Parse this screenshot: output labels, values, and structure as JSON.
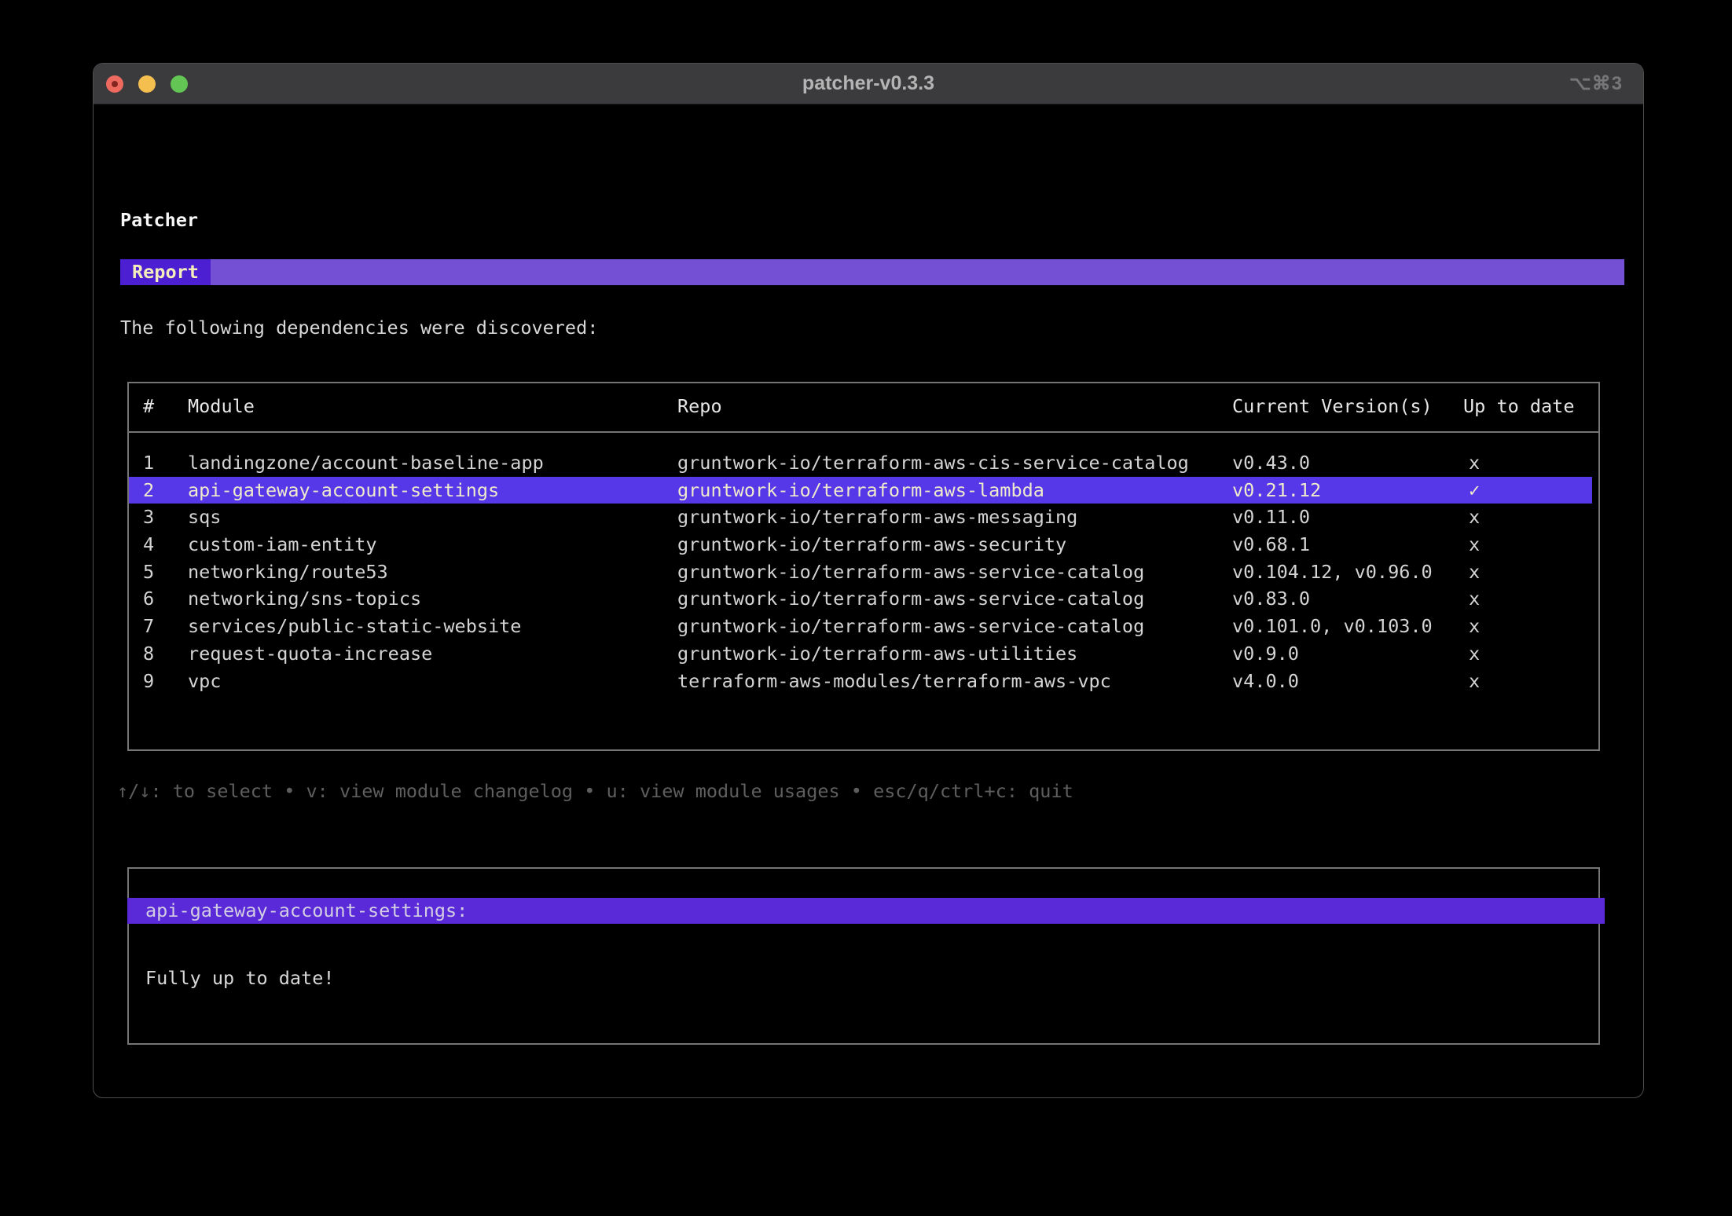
{
  "window": {
    "title": "patcher-v0.3.3",
    "shortcut": "⌥⌘3"
  },
  "app": {
    "heading": "Patcher",
    "tab_label": "Report",
    "intro": "The following dependencies were discovered:",
    "table": {
      "columns": [
        "#",
        "Module",
        "Repo",
        "Current Version(s)",
        "Up to date"
      ],
      "rows": [
        {
          "num": "1",
          "module": "landingzone/account-baseline-app",
          "repo": "gruntwork-io/terraform-aws-cis-service-catalog",
          "versions": "v0.43.0",
          "up_to_date": "x",
          "selected": false
        },
        {
          "num": "2",
          "module": "api-gateway-account-settings",
          "repo": "gruntwork-io/terraform-aws-lambda",
          "versions": "v0.21.12",
          "up_to_date": "✓",
          "selected": true
        },
        {
          "num": "3",
          "module": "sqs",
          "repo": "gruntwork-io/terraform-aws-messaging",
          "versions": "v0.11.0",
          "up_to_date": "x",
          "selected": false
        },
        {
          "num": "4",
          "module": "custom-iam-entity",
          "repo": "gruntwork-io/terraform-aws-security",
          "versions": "v0.68.1",
          "up_to_date": "x",
          "selected": false
        },
        {
          "num": "5",
          "module": "networking/route53",
          "repo": "gruntwork-io/terraform-aws-service-catalog",
          "versions": "v0.104.12, v0.96.0",
          "up_to_date": "x",
          "selected": false
        },
        {
          "num": "6",
          "module": "networking/sns-topics",
          "repo": "gruntwork-io/terraform-aws-service-catalog",
          "versions": "v0.83.0",
          "up_to_date": "x",
          "selected": false
        },
        {
          "num": "7",
          "module": "services/public-static-website",
          "repo": "gruntwork-io/terraform-aws-service-catalog",
          "versions": "v0.101.0, v0.103.0",
          "up_to_date": "x",
          "selected": false
        },
        {
          "num": "8",
          "module": "request-quota-increase",
          "repo": "gruntwork-io/terraform-aws-utilities",
          "versions": "v0.9.0",
          "up_to_date": "x",
          "selected": false
        },
        {
          "num": "9",
          "module": "vpc",
          "repo": "terraform-aws-modules/terraform-aws-vpc",
          "versions": "v4.0.0",
          "up_to_date": "x",
          "selected": false
        }
      ]
    },
    "help": "↑/↓: to select • v: view module changelog • u: view module usages • esc/q/ctrl+c: quit",
    "detail": {
      "title": "api-gateway-account-settings:",
      "body": "Fully up to date!"
    }
  },
  "colors": {
    "accent_banner": "#7450d5",
    "accent_chip": "#4c20d2",
    "row_highlight": "#5638e8",
    "detail_highlight": "#5a2ad8",
    "highlight_text": "#f0eacd",
    "terminal_text": "#d6d6d6",
    "help_text": "#5e5e5e",
    "titlebar_bg": "#3b3b3d"
  }
}
